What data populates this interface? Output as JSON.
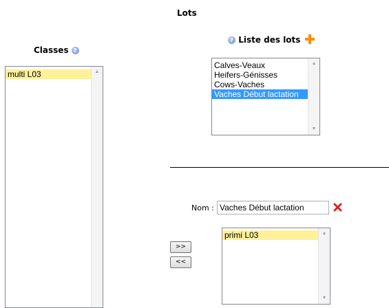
{
  "page": {
    "title": "Lots"
  },
  "classes": {
    "heading": "Classes",
    "items": [
      {
        "label": "multi L03",
        "highlighted": true
      }
    ]
  },
  "lots": {
    "heading": "Liste des lots",
    "add_icon": "plus-icon",
    "items": [
      {
        "label": "Calves-Veaux"
      },
      {
        "label": "Heifers-Génisses"
      },
      {
        "label": "Cows-Vaches"
      },
      {
        "label": "Vaches Début lactation",
        "selected": true
      }
    ]
  },
  "form": {
    "name_label": "Nom :",
    "name_value": "Vaches Début lactation",
    "delete_icon": "close-icon",
    "move_right_label": ">>",
    "move_left_label": "<<",
    "assigned_items": [
      {
        "label": "primi L03",
        "highlighted": true
      }
    ]
  },
  "colors": {
    "highlight": "#fff09a",
    "selection": "#3399ff",
    "add_icon": "#ff8c00",
    "delete_icon": "#dd2222"
  }
}
